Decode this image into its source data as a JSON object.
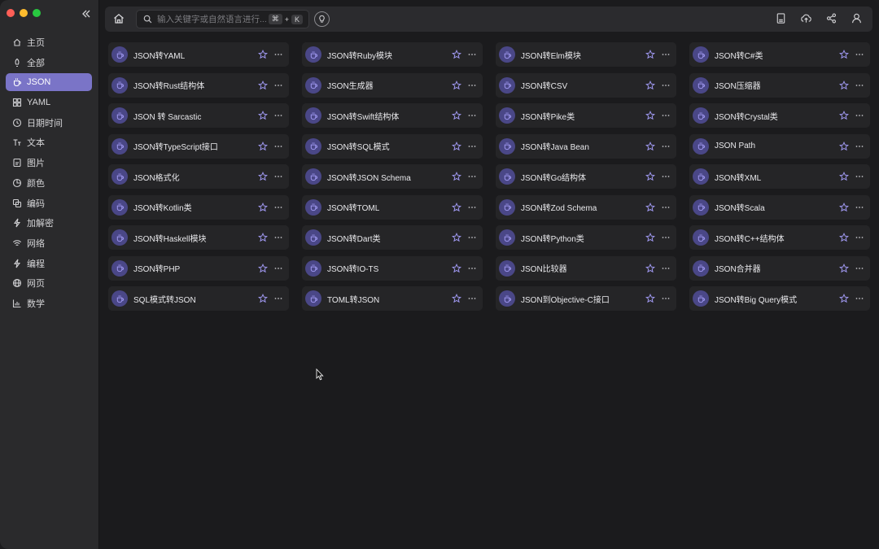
{
  "search": {
    "placeholder": "输入关键字或自然语言进行...",
    "shortcut_key1": "⌘",
    "shortcut_plus": "+",
    "shortcut_key2": "K"
  },
  "sidebar": {
    "items": [
      {
        "label": "主页",
        "icon": "home-icon"
      },
      {
        "label": "全部",
        "icon": "rocket-icon"
      },
      {
        "label": "JSON",
        "icon": "cup-icon",
        "active": true
      },
      {
        "label": "YAML",
        "icon": "grid-icon"
      },
      {
        "label": "日期时间",
        "icon": "clock-icon"
      },
      {
        "label": "文本",
        "icon": "text-icon"
      },
      {
        "label": "图片",
        "icon": "image-icon"
      },
      {
        "label": "颜色",
        "icon": "palette-icon"
      },
      {
        "label": "编码",
        "icon": "copy-icon"
      },
      {
        "label": "加解密",
        "icon": "bolt-icon"
      },
      {
        "label": "网络",
        "icon": "wifi-icon"
      },
      {
        "label": "编程",
        "icon": "bolt-icon"
      },
      {
        "label": "网页",
        "icon": "globe-icon"
      },
      {
        "label": "数学",
        "icon": "chart-icon"
      }
    ]
  },
  "tools": [
    "JSON转YAML",
    "JSON转Ruby模块",
    "JSON转Elm模块",
    "JSON转C#类",
    "JSON转Rust结构体",
    "JSON生成器",
    "JSON转CSV",
    "JSON压缩器",
    "JSON 转 Sarcastic",
    "JSON转Swift结构体",
    "JSON转Pike类",
    "JSON转Crystal类",
    "JSON转TypeScript接口",
    "JSON转SQL模式",
    "JSON转Java Bean",
    "JSON Path",
    "JSON格式化",
    "JSON转JSON Schema",
    "JSON转Go结构体",
    "JSON转XML",
    "JSON转Kotlin类",
    "JSON转TOML",
    "JSON转Zod Schema",
    "JSON转Scala",
    "JSON转Haskell模块",
    "JSON转Dart类",
    "JSON转Python类",
    "JSON转C++结构体",
    "JSON转PHP",
    "JSON转IO-TS",
    "JSON比较器",
    "JSON合并器",
    "SQL模式转JSON",
    "TOML转JSON",
    "JSON到Objective-C接口",
    "JSON转Big Query模式"
  ],
  "colors": {
    "accent": "#7a74c7",
    "badge": "#4a4787",
    "icon_accent": "#9f98f0"
  }
}
